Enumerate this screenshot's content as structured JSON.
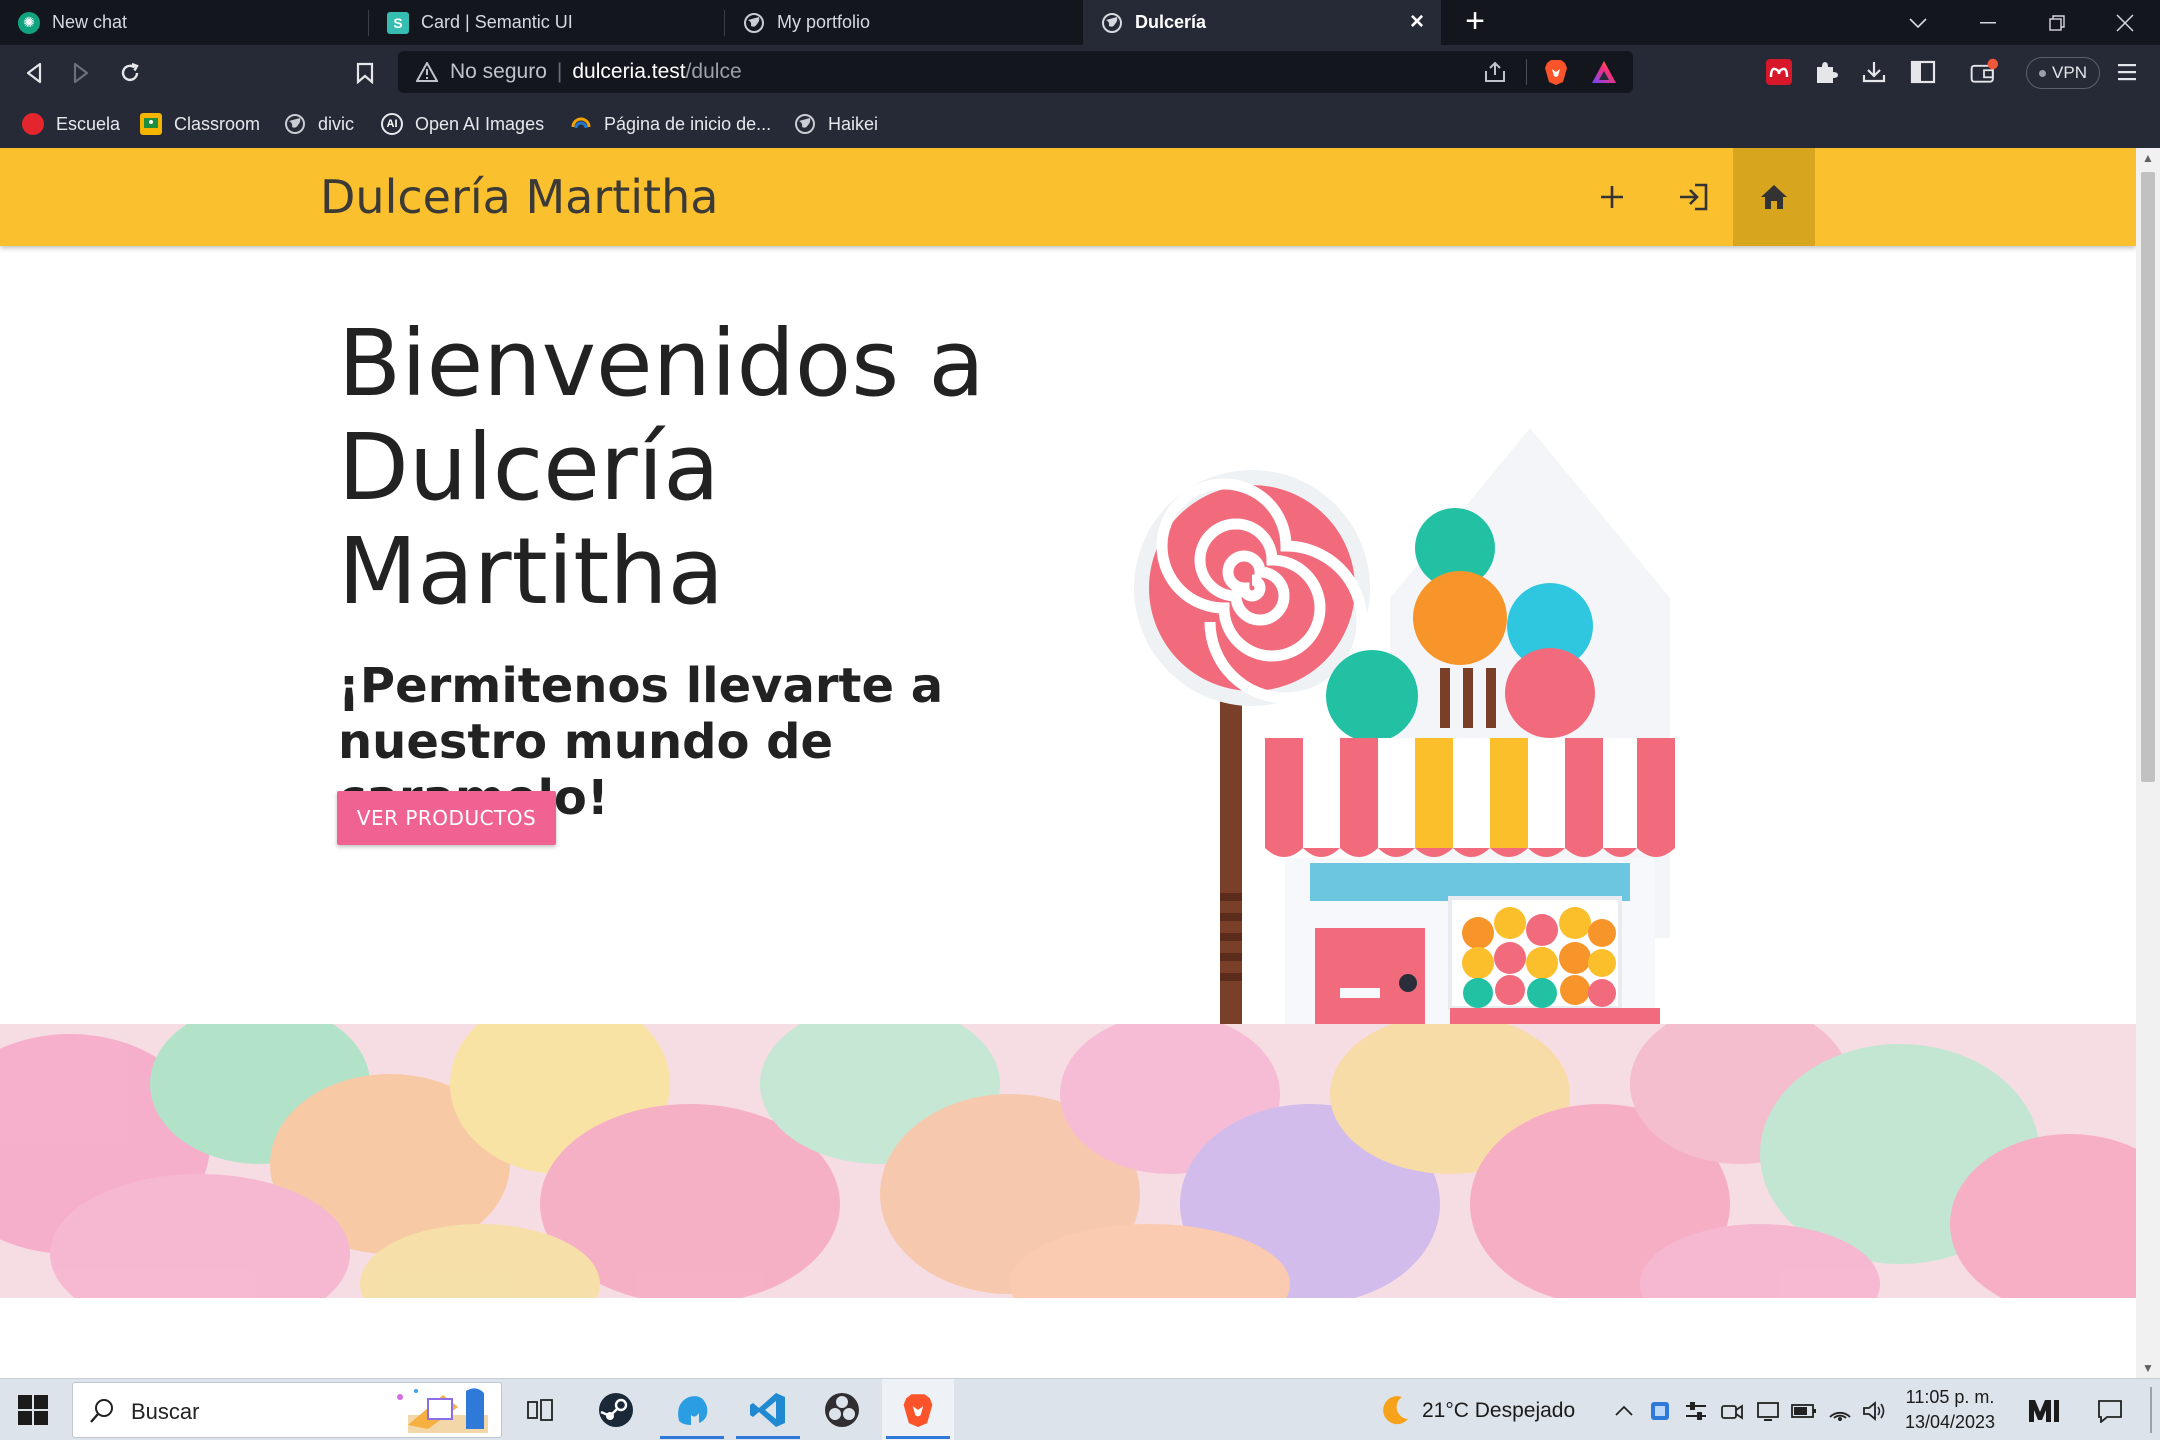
{
  "browser": {
    "tabs": [
      {
        "title": "New chat",
        "active": false
      },
      {
        "title": "Card | Semantic UI",
        "active": false
      },
      {
        "title": "My portfolio",
        "active": false
      },
      {
        "title": "Dulcería",
        "active": true
      }
    ],
    "address": {
      "security": "No seguro",
      "host": "dulceria.test",
      "path": "/dulce"
    },
    "vpn_label": "VPN",
    "bookmarks": [
      {
        "label": "Escuela"
      },
      {
        "label": "Classroom"
      },
      {
        "label": "divic"
      },
      {
        "label": "Open AI Images"
      },
      {
        "label": "Página de inicio de..."
      },
      {
        "label": "Haikei"
      }
    ]
  },
  "site": {
    "brand": "Dulcería Martitha",
    "nav_icons": [
      "plus-icon",
      "login-icon",
      "home-icon"
    ],
    "hero": {
      "title": "Bienvenidos a Dulcería Martitha",
      "subtitle": "¡Permitenos llevarte a nuestro mundo de caramelo!",
      "cta": "VER PRODUCTOS"
    },
    "colors": {
      "navbar": "#fbc02d",
      "cta": "#f06292"
    }
  },
  "taskbar": {
    "search_placeholder": "Buscar",
    "weather": "21°C  Despejado",
    "time": "11:05 p. m.",
    "date": "13/04/2023"
  }
}
